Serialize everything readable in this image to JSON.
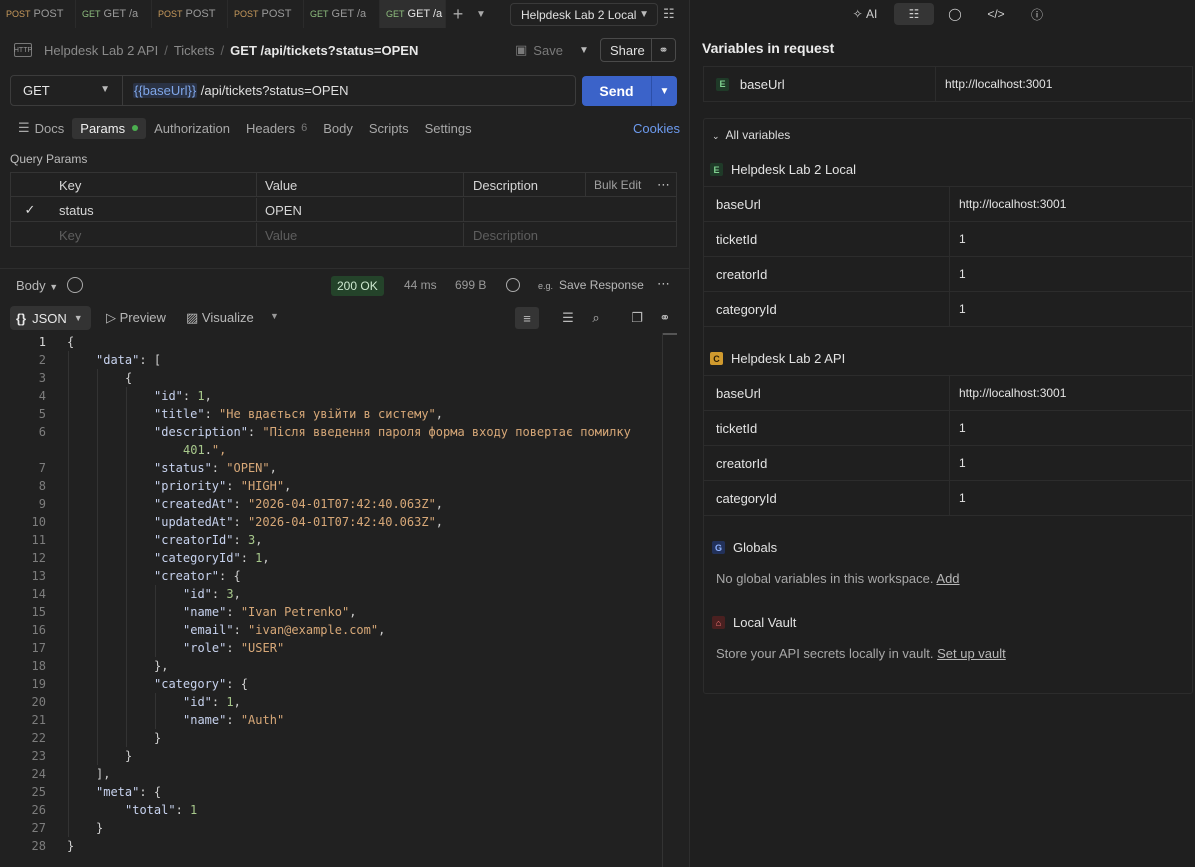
{
  "tabs": [
    {
      "method": "POST",
      "title": "POST"
    },
    {
      "method": "GET",
      "title": "GET /a"
    },
    {
      "method": "POST",
      "title": "POST"
    },
    {
      "method": "POST",
      "title": "POST"
    },
    {
      "method": "GET",
      "title": "GET /a"
    },
    {
      "method": "GET",
      "title": "GET /a"
    }
  ],
  "environment": {
    "selected": "Helpdesk Lab 2 Local"
  },
  "breadcrumb": {
    "collection": "Helpdesk Lab 2 API",
    "folder": "Tickets",
    "request": "GET /api/tickets?status=OPEN"
  },
  "toolbar": {
    "save_label": "Save",
    "share_label": "Share"
  },
  "request": {
    "method": "GET",
    "url_var": "{{baseUrl}}",
    "url_path": " /api/tickets?status=OPEN",
    "send_label": "Send"
  },
  "request_tabs": {
    "docs": "Docs",
    "params": "Params",
    "authorization": "Authorization",
    "headers": "Headers",
    "headers_count": "6",
    "body": "Body",
    "scripts": "Scripts",
    "settings": "Settings",
    "cookies": "Cookies"
  },
  "params": {
    "title": "Query Params",
    "headers": {
      "key": "Key",
      "value": "Value",
      "description": "Description",
      "bulk_edit": "Bulk Edit"
    },
    "rows": [
      {
        "key": "status",
        "value": "OPEN",
        "checked": true
      }
    ],
    "placeholder": {
      "key": "Key",
      "value": "Value",
      "description": "Description"
    }
  },
  "response": {
    "body_label": "Body",
    "status": "200 OK",
    "time": "44 ms",
    "size": "699 B",
    "save_response": "Save Response",
    "format": "JSON",
    "preview": "Preview",
    "visualize": "Visualize"
  },
  "code_lines": [
    "{",
    "    \"data\": [",
    "        {",
    "            \"id\": 1,",
    "            \"title\": \"Не вдається увійти в систему\",",
    "            \"description\": \"Після введення пароля форма входу повертає помилку",
    "                401.\",",
    "            \"status\": \"OPEN\",",
    "            \"priority\": \"HIGH\",",
    "            \"createdAt\": \"2026-04-01T07:42:40.063Z\",",
    "            \"updatedAt\": \"2026-04-01T07:42:40.063Z\",",
    "            \"creatorId\": 3,",
    "            \"categoryId\": 1,",
    "            \"creator\": {",
    "                \"id\": 3,",
    "                \"name\": \"Ivan Petrenko\",",
    "                \"email\": \"ivan@example.com\",",
    "                \"role\": \"USER\"",
    "            },",
    "            \"category\": {",
    "                \"id\": 1,",
    "                \"name\": \"Auth\"",
    "            }",
    "        }",
    "    ],",
    "    \"meta\": {",
    "        \"total\": 1",
    "    }",
    "}"
  ],
  "right": {
    "toolbar": {
      "ai": "AI"
    },
    "title": "Variables in request",
    "in_request": [
      {
        "key": "baseUrl",
        "value": "http://localhost:3001"
      }
    ],
    "all_variables": "All variables",
    "env_local": {
      "name": "Helpdesk Lab 2 Local",
      "vars": [
        {
          "key": "baseUrl",
          "value": "http://localhost:3001"
        },
        {
          "key": "ticketId",
          "value": "1"
        },
        {
          "key": "creatorId",
          "value": "1"
        },
        {
          "key": "categoryId",
          "value": "1"
        }
      ]
    },
    "collection": {
      "name": "Helpdesk Lab 2 API",
      "vars": [
        {
          "key": "baseUrl",
          "value": "http://localhost:3001"
        },
        {
          "key": "ticketId",
          "value": "1"
        },
        {
          "key": "creatorId",
          "value": "1"
        },
        {
          "key": "categoryId",
          "value": "1"
        }
      ]
    },
    "globals": {
      "name": "Globals",
      "text": "No global variables in this workspace.",
      "link": "Add"
    },
    "vault": {
      "name": "Local Vault",
      "text": "Store your API secrets locally in vault.",
      "link": "Set up vault"
    }
  }
}
